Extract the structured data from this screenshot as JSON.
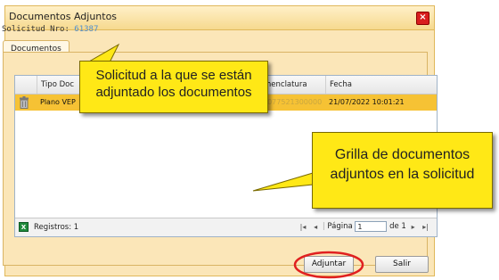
{
  "window": {
    "title": "Documentos Adjuntos",
    "close_icon": "close-icon"
  },
  "solicitud": {
    "label": "Solicitud Nro:",
    "number": "61387"
  },
  "tabs": [
    {
      "label": "Documentos"
    }
  ],
  "grid": {
    "columns": [
      "Tipo Doc",
      "menclatura",
      "Fecha"
    ],
    "rows": [
      {
        "tipo": "Plano VEP",
        "nomenclatura": "4077521300000",
        "fecha": "21/07/2022 10:01:21"
      }
    ]
  },
  "status": {
    "registros_label": "Registros: 1",
    "page_label": "Página",
    "page_value": "1",
    "page_of": "de 1"
  },
  "buttons": {
    "adjuntar": "Adjuntar",
    "salir": "Salir"
  },
  "callouts": {
    "solicitud_line1": "Solicitud a la que se están",
    "solicitud_line2": "adjuntado los documentos",
    "grilla_line1": "Grilla de documentos",
    "grilla_line2": "adjuntos en la solicitud"
  },
  "colors": {
    "selected_row": "#f6c234",
    "callout": "#ffe816",
    "highlight_ring": "#e02020",
    "panel": "#fbe6b8"
  }
}
